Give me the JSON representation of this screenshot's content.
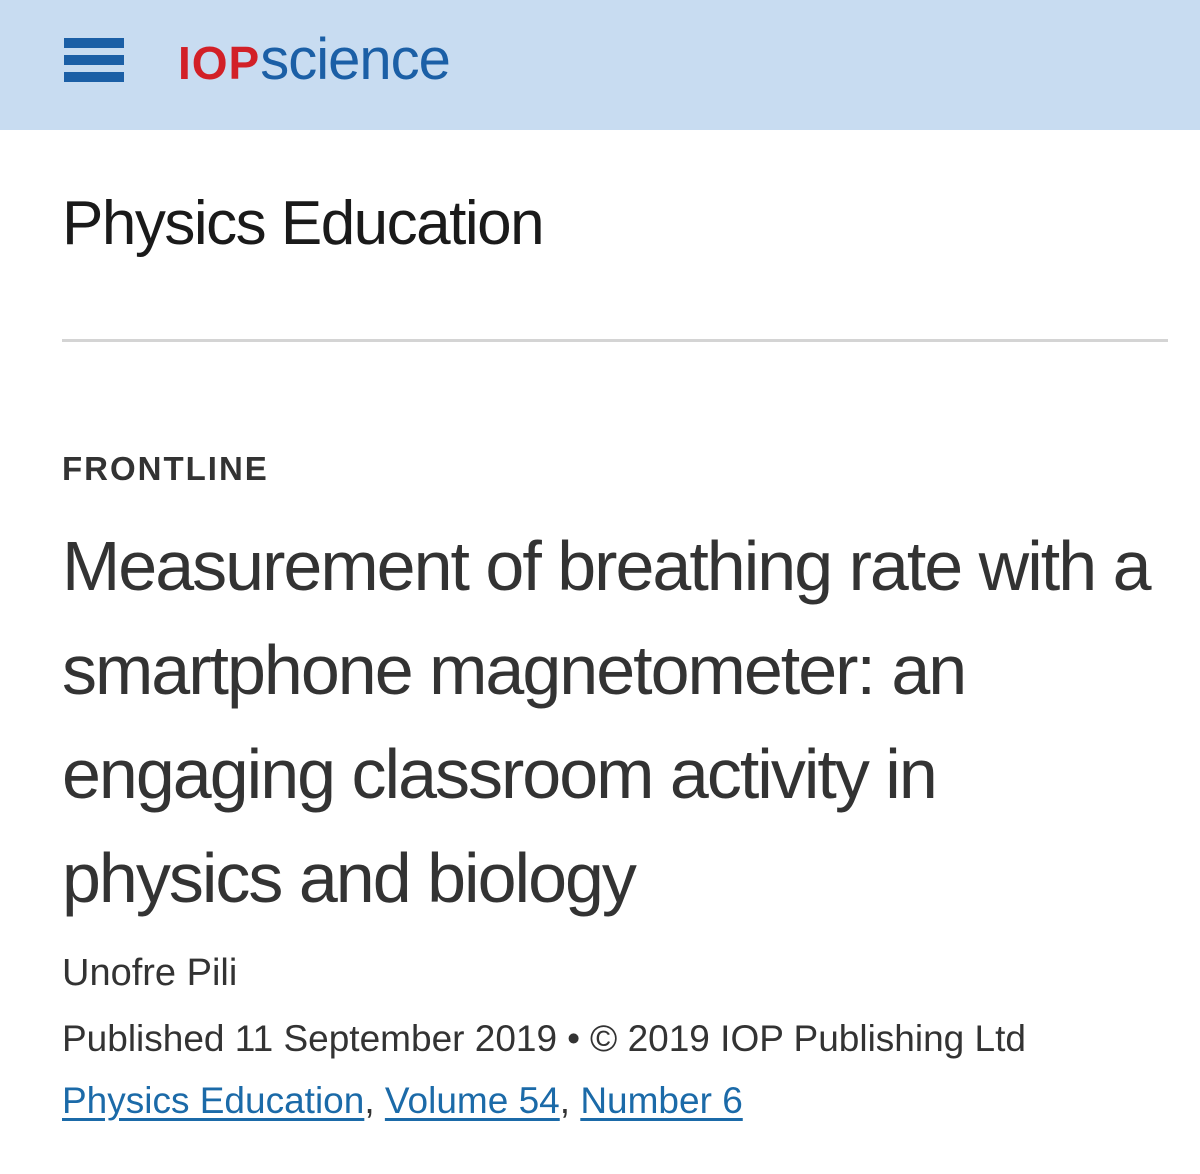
{
  "header": {
    "menu_icon": "hamburger-menu-icon",
    "logo_part1": "IOP",
    "logo_part2": "science",
    "colors": {
      "background": "#c8dcf1",
      "logo_red": "#d22027",
      "logo_blue": "#1b5fa6"
    }
  },
  "journal": {
    "title": "Physics Education"
  },
  "article": {
    "section": "FRONTLINE",
    "title": "Measurement of breathing rate with a smartphone magnetometer: an engaging classroom activity in physics and biology",
    "author": "Unofre Pili",
    "published": "Published 11 September 2019",
    "bullet": "•",
    "copyright": "© 2019 IOP Publishing Ltd"
  },
  "citation": {
    "journal_link": "Physics Education",
    "volume_link": "Volume 54",
    "number_link": "Number 6",
    "separator": ","
  },
  "colors": {
    "link": "#1b6aa8",
    "text": "#333333"
  }
}
